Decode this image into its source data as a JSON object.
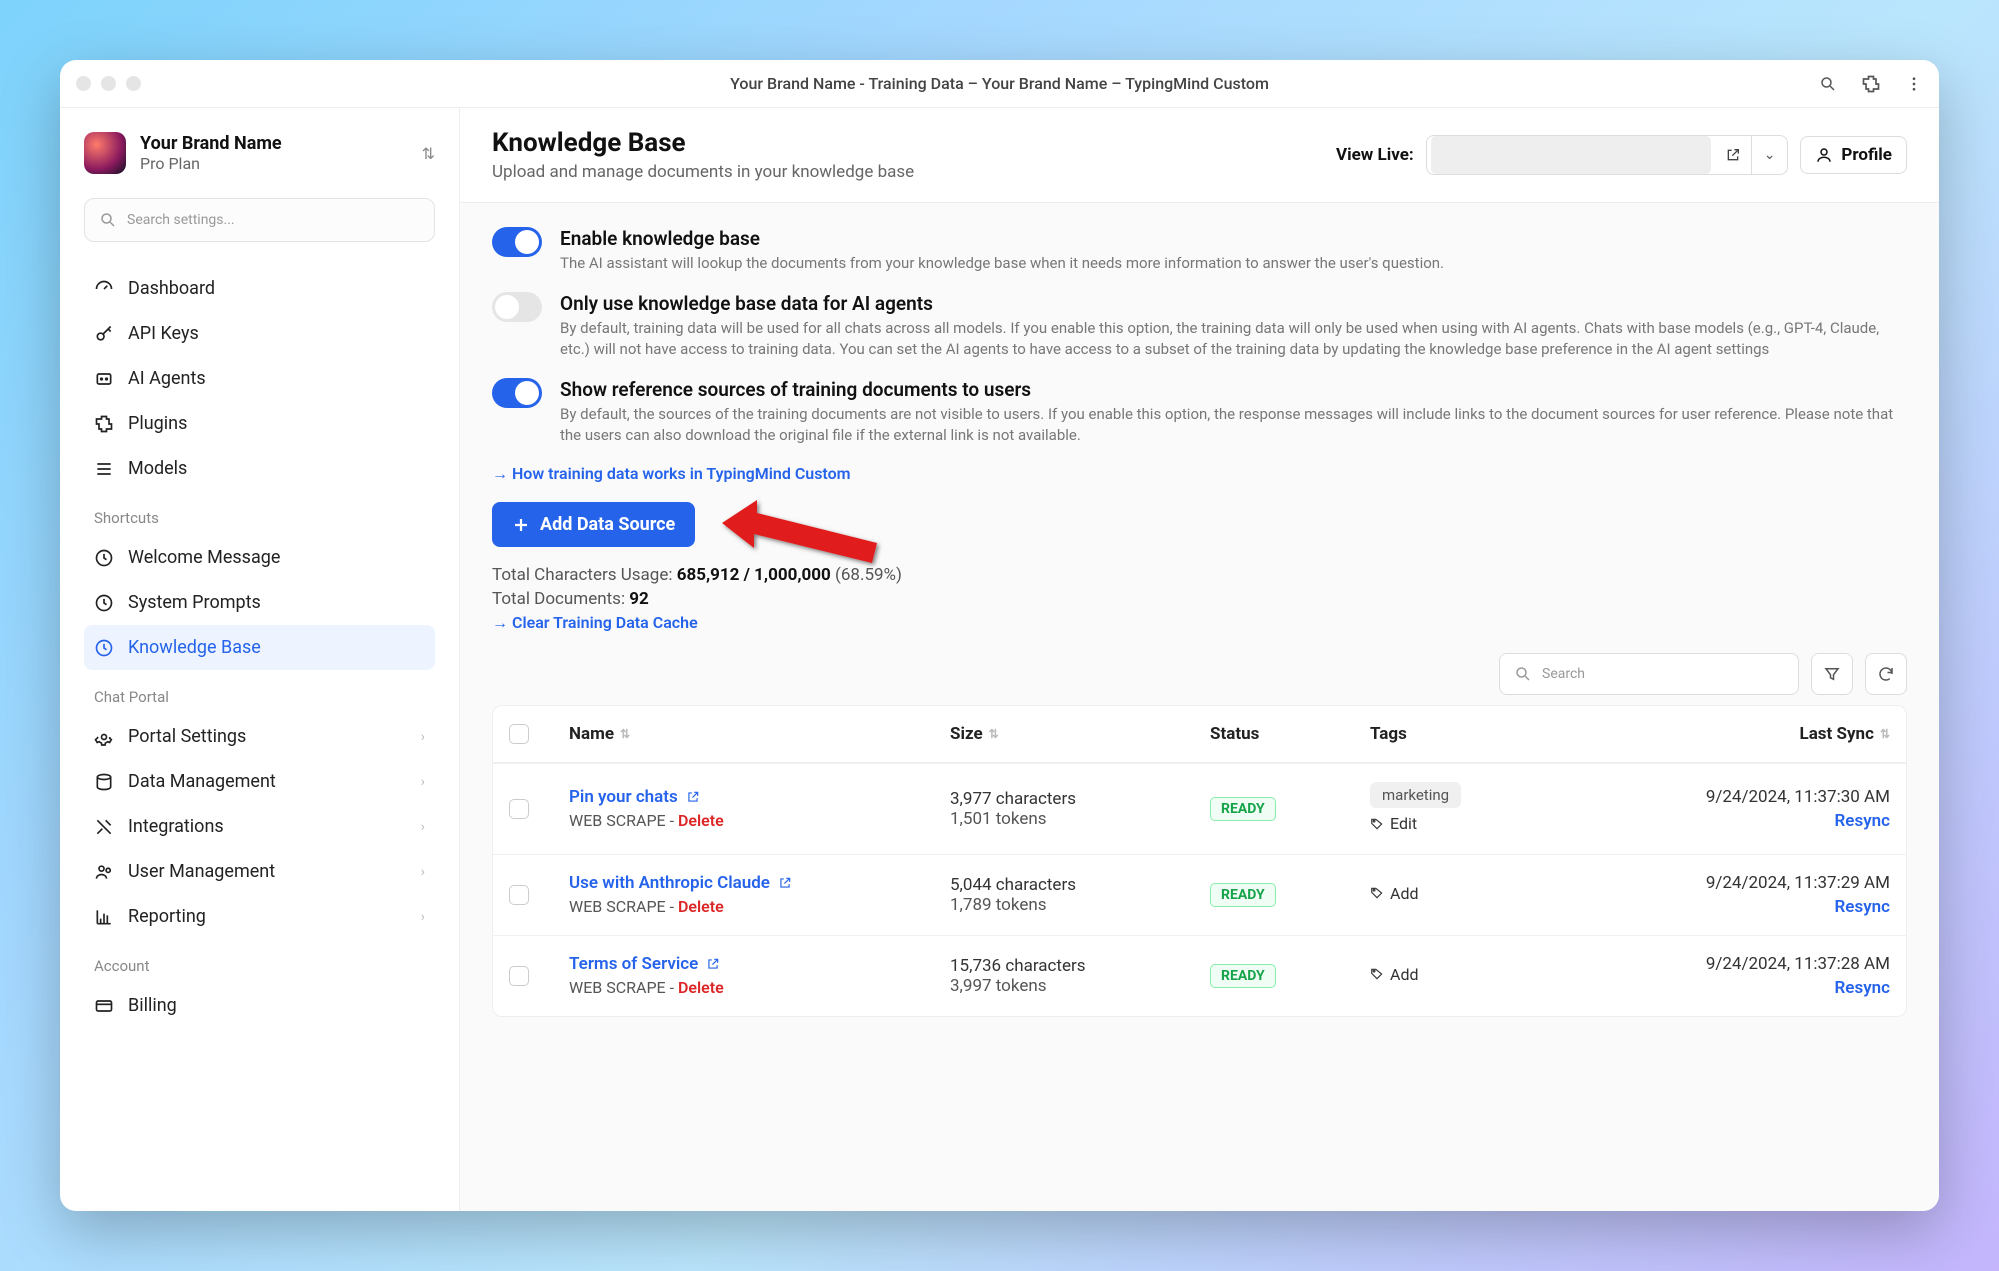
{
  "window_title": "Your Brand Name - Training Data – Your Brand Name – TypingMind Custom",
  "brand": {
    "name": "Your Brand Name",
    "plan": "Pro Plan"
  },
  "search_placeholder": "Search settings...",
  "nav": {
    "main": [
      {
        "label": "Dashboard"
      },
      {
        "label": "API Keys"
      },
      {
        "label": "AI Agents"
      },
      {
        "label": "Plugins"
      },
      {
        "label": "Models"
      }
    ],
    "shortcuts_label": "Shortcuts",
    "shortcuts": [
      {
        "label": "Welcome Message"
      },
      {
        "label": "System Prompts"
      },
      {
        "label": "Knowledge Base",
        "active": true
      }
    ],
    "chat_label": "Chat Portal",
    "chat": [
      {
        "label": "Portal Settings"
      },
      {
        "label": "Data Management"
      },
      {
        "label": "Integrations"
      },
      {
        "label": "User Management"
      },
      {
        "label": "Reporting"
      }
    ],
    "account_label": "Account",
    "account": [
      {
        "label": "Billing"
      }
    ]
  },
  "header": {
    "title": "Knowledge Base",
    "subtitle": "Upload and manage documents in your knowledge base",
    "view_live": "View Live:",
    "profile": "Profile"
  },
  "settings": {
    "s1_title": "Enable knowledge base",
    "s1_desc": "The AI assistant will lookup the documents from your knowledge base when it needs more information to answer the user's question.",
    "s2_title": "Only use knowledge base data for AI agents",
    "s2_desc": "By default, training data will be used for all chats across all models. If you enable this option, the training data will only be used when using with AI agents. Chats with base models (e.g., GPT-4, Claude, etc.) will not have access to training data. You can set the AI agents to have access to a subset of the training data by updating the knowledge base preference in the AI agent settings",
    "s3_title": "Show reference sources of training documents to users",
    "s3_desc": "By default, the sources of the training documents are not visible to users. If you enable this option, the response messages will include links to the document sources for user reference. Please note that the users can also download the original file if the external link is not available.",
    "how_link": "→ How training data works in TypingMind Custom",
    "add_btn": "Add Data Source"
  },
  "usage": {
    "chars_label": "Total Characters Usage: ",
    "chars_value": "685,912 / 1,000,000",
    "chars_pct": " (68.59%)",
    "docs_label": "Total Documents: ",
    "docs_value": "92",
    "clear_link": "→ Clear Training Data Cache"
  },
  "table": {
    "search_placeholder": "Search",
    "headers": {
      "name": "Name",
      "size": "Size",
      "status": "Status",
      "tags": "Tags",
      "last_sync": "Last Sync"
    },
    "rows": [
      {
        "name": "Pin your chats",
        "type": "WEB SCRAPE",
        "delete": "Delete",
        "size1": "3,977 characters",
        "size2": "1,501 tokens",
        "status": "READY",
        "tag": "marketing",
        "tag_action": "Edit",
        "date": "9/24/2024, 11:37:30 AM",
        "resync": "Resync"
      },
      {
        "name": "Use with Anthropic Claude",
        "type": "WEB SCRAPE",
        "delete": "Delete",
        "size1": "5,044 characters",
        "size2": "1,789 tokens",
        "status": "READY",
        "tag": "",
        "tag_action": "Add",
        "date": "9/24/2024, 11:37:29 AM",
        "resync": "Resync"
      },
      {
        "name": "Terms of Service",
        "type": "WEB SCRAPE",
        "delete": "Delete",
        "size1": "15,736 characters",
        "size2": "3,997 tokens",
        "status": "READY",
        "tag": "",
        "tag_action": "Add",
        "date": "9/24/2024, 11:37:28 AM",
        "resync": "Resync"
      }
    ]
  }
}
